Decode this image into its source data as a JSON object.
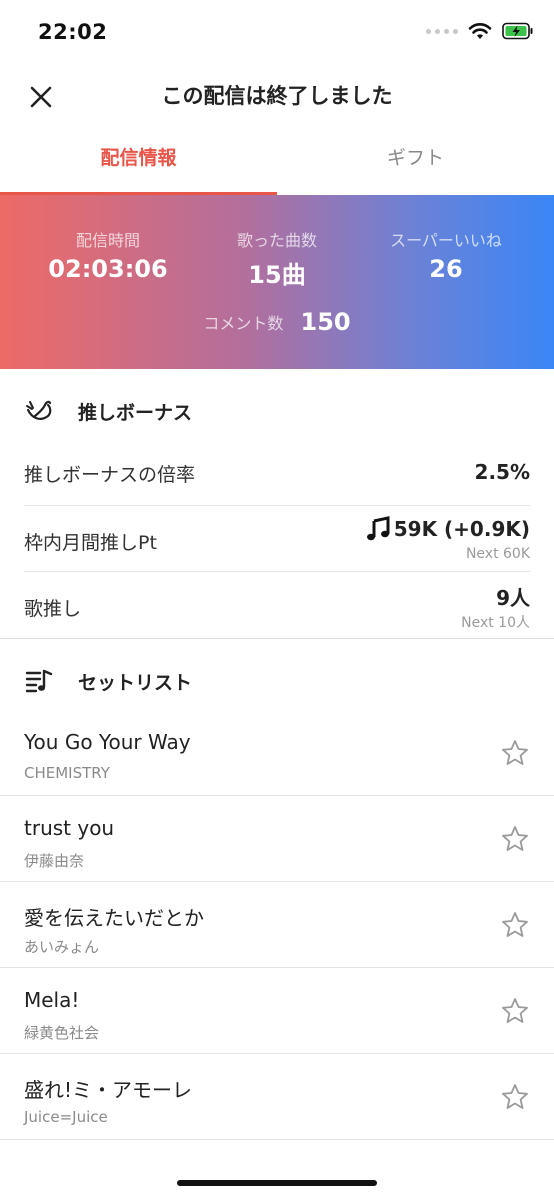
{
  "status_bar": {
    "time": "22:02"
  },
  "nav": {
    "title": "この配信は終了しました"
  },
  "tabs": [
    {
      "label": "配信情報",
      "active": true
    },
    {
      "label": "ギフト",
      "active": false
    }
  ],
  "stats": {
    "duration_label": "配信時間",
    "duration_value": "02:03:06",
    "songs_label": "歌った曲数",
    "songs_value": "15曲",
    "super_like_label": "スーパーいいね",
    "super_like_value": "26",
    "comments_label": "コメント数",
    "comments_value": "150"
  },
  "oshi_bonus": {
    "title": "推しボーナス",
    "rows": [
      {
        "label": "推しボーナスの倍率",
        "value": "2.5%"
      },
      {
        "label": "枠内月間推しPt",
        "value": "59K (+0.9K)",
        "sub": "Next 60K"
      },
      {
        "label": "歌推し",
        "value": "9人",
        "sub": "Next 10人"
      }
    ]
  },
  "setlist": {
    "title": "セットリスト",
    "songs": [
      {
        "title": "You Go Your Way",
        "artist": "CHEMISTRY"
      },
      {
        "title": "trust you",
        "artist": "伊藤由奈"
      },
      {
        "title": "愛を伝えたいだとか",
        "artist": "あいみょん"
      },
      {
        "title": "Mela!",
        "artist": "緑黄色社会"
      },
      {
        "title": "盛れ!ミ・アモーレ",
        "artist": "Juice=Juice"
      }
    ]
  },
  "colors": {
    "accent": "#e8564a",
    "gradient_start": "#ee6a66",
    "gradient_end": "#3a86f7"
  }
}
